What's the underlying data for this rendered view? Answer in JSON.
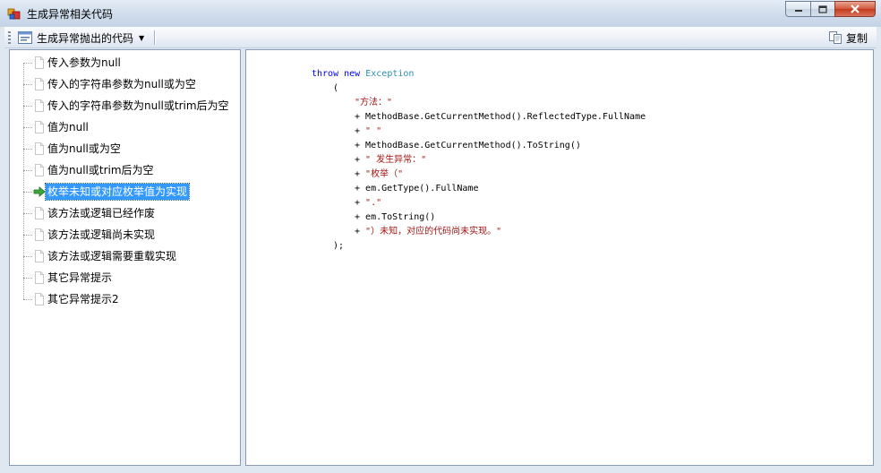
{
  "window": {
    "title": "生成异常相关代码",
    "controls": [
      "minimize-icon",
      "maximize-icon",
      "close-icon"
    ]
  },
  "toolbar": {
    "dropdown_label": "生成异常抛出的代码",
    "copy_label": "复制"
  },
  "tree": {
    "selected_index": 6,
    "items": [
      {
        "label": "传入参数为null"
      },
      {
        "label": "传入的字符串参数为null或为空"
      },
      {
        "label": "传入的字符串参数为null或trim后为空"
      },
      {
        "label": "值为null"
      },
      {
        "label": "值为null或为空"
      },
      {
        "label": "值为null或trim后为空"
      },
      {
        "label": "枚举未知或对应枚举值为实现"
      },
      {
        "label": "该方法或逻辑已经作废"
      },
      {
        "label": "该方法或逻辑尚未实现"
      },
      {
        "label": "该方法或逻辑需要重载实现"
      },
      {
        "label": "其它异常提示"
      },
      {
        "label": "其它异常提示2"
      }
    ]
  },
  "code": {
    "line1": {
      "kw1": "throw",
      "kw2": "new",
      "type": "Exception"
    },
    "line2": "(",
    "line3": "\"方法：\"",
    "line4_op": "+ ",
    "line4": "MethodBase.GetCurrentMethod().ReflectedType.FullName",
    "line5_op": "+ ",
    "line5": "\" \"",
    "line6_op": "+ ",
    "line6": "MethodBase.GetCurrentMethod().ToString()",
    "line7_op": "+ ",
    "line7": "\" 发生异常：\"",
    "line8_op": "+ ",
    "line8": "\"枚举（\"",
    "line9_op": "+ ",
    "line9": "em.GetType().FullName",
    "line10_op": "+ ",
    "line10": "\".\"",
    "line11_op": "+ ",
    "line11": "em.ToString()",
    "line12_op": "+ ",
    "line12": "\"）未知，对应的代码尚未实现。\"",
    "line13": ");"
  },
  "colors": {
    "keyword": "#0000ff",
    "type": "#2b91af",
    "string": "#a31515",
    "selection": "#3399ff"
  }
}
